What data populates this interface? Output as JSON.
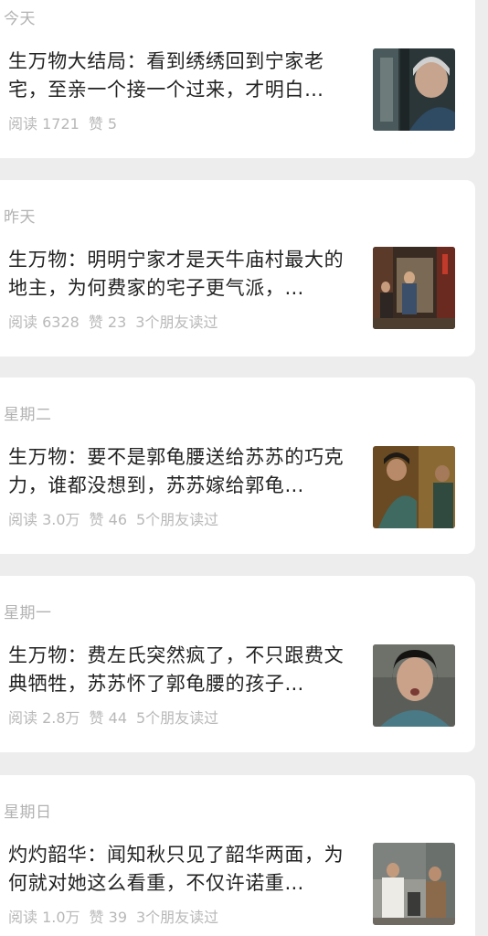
{
  "feed": [
    {
      "day": "今天",
      "title": "生万物大结局：看到绣绣回到宁家老宅，至亲一个接一个过来，才明白…",
      "reads": "阅读 1721",
      "likes": "赞 5",
      "friends": "",
      "thumb": "old-woman-doorway-image"
    },
    {
      "day": "昨天",
      "title": "生万物：明明宁家才是天牛庙村最大的地主，为何费家的宅子更气派，…",
      "reads": "阅读 6328",
      "likes": "赞 23",
      "friends": "3个朋友读过",
      "thumb": "courtyard-scene-image"
    },
    {
      "day": "星期二",
      "title": "生万物：要不是郭龟腰送给苏苏的巧克力，谁都没想到，苏苏嫁给郭龟…",
      "reads": "阅读 3.0万",
      "likes": "赞 46",
      "friends": "5个朋友读过",
      "thumb": "two-people-scene-image"
    },
    {
      "day": "星期一",
      "title": "生万物：费左氏突然疯了，不只跟费文典牺牲，苏苏怀了郭龟腰的孩子…",
      "reads": "阅读 2.8万",
      "likes": "赞 44",
      "friends": "5个朋友读过",
      "thumb": "woman-portrait-image"
    },
    {
      "day": "星期日",
      "title": "灼灼韶华：闻知秋只见了韶华两面，为何就对她这么看重，不仅许诺重…",
      "reads": "阅读 1.0万",
      "likes": "赞 39",
      "friends": "3个朋友读过",
      "thumb": "street-scene-image"
    }
  ]
}
